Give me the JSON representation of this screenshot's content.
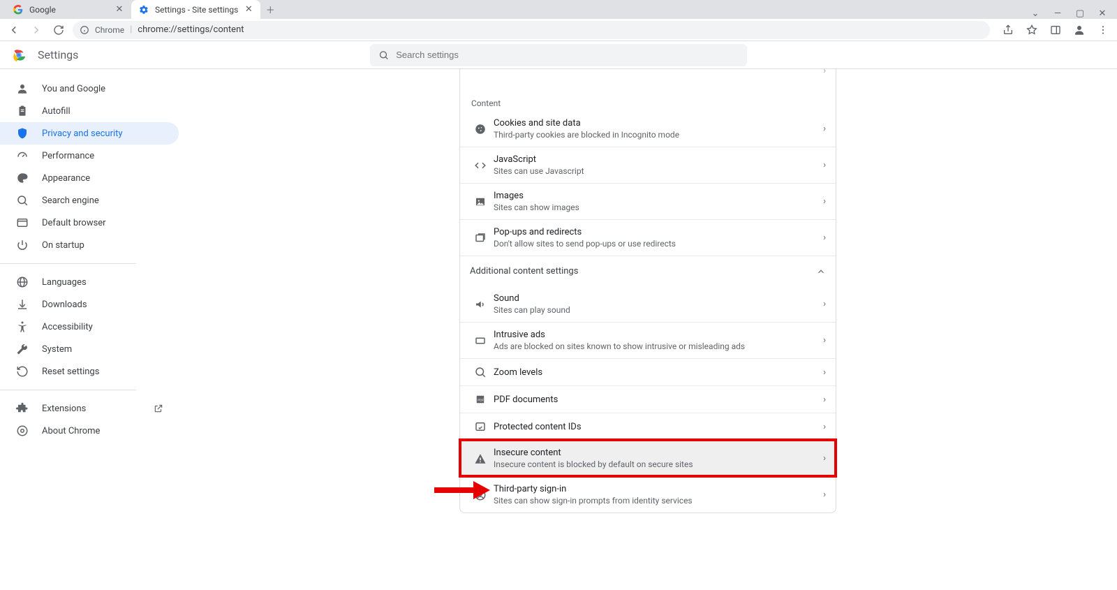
{
  "tabs": [
    {
      "title": "Google"
    },
    {
      "title": "Settings - Site settings"
    }
  ],
  "omnibox": {
    "chip": "Chrome",
    "url": "chrome://settings/content"
  },
  "header": {
    "title": "Settings",
    "search_placeholder": "Search settings"
  },
  "sidebar": {
    "items": [
      {
        "label": "You and Google"
      },
      {
        "label": "Autofill"
      },
      {
        "label": "Privacy and security"
      },
      {
        "label": "Performance"
      },
      {
        "label": "Appearance"
      },
      {
        "label": "Search engine"
      },
      {
        "label": "Default browser"
      },
      {
        "label": "On startup"
      }
    ],
    "items2": [
      {
        "label": "Languages"
      },
      {
        "label": "Downloads"
      },
      {
        "label": "Accessibility"
      },
      {
        "label": "System"
      },
      {
        "label": "Reset settings"
      }
    ],
    "items3": [
      {
        "label": "Extensions"
      },
      {
        "label": "About Chrome"
      }
    ]
  },
  "content": {
    "section1_label": "Content",
    "rows1": [
      {
        "title": "Cookies and site data",
        "sub": "Third-party cookies are blocked in Incognito mode"
      },
      {
        "title": "JavaScript",
        "sub": "Sites can use Javascript"
      },
      {
        "title": "Images",
        "sub": "Sites can show images"
      },
      {
        "title": "Pop-ups and redirects",
        "sub": "Don't allow sites to send pop-ups or use redirects"
      }
    ],
    "section2_label": "Additional content settings",
    "rows2": [
      {
        "title": "Sound",
        "sub": "Sites can play sound"
      },
      {
        "title": "Intrusive ads",
        "sub": "Ads are blocked on sites known to show intrusive or misleading ads"
      },
      {
        "title": "Zoom levels",
        "sub": ""
      },
      {
        "title": "PDF documents",
        "sub": ""
      },
      {
        "title": "Protected content IDs",
        "sub": ""
      },
      {
        "title": "Insecure content",
        "sub": "Insecure content is blocked by default on secure sites"
      },
      {
        "title": "Third-party sign-in",
        "sub": "Sites can show sign-in prompts from identity services"
      }
    ]
  }
}
